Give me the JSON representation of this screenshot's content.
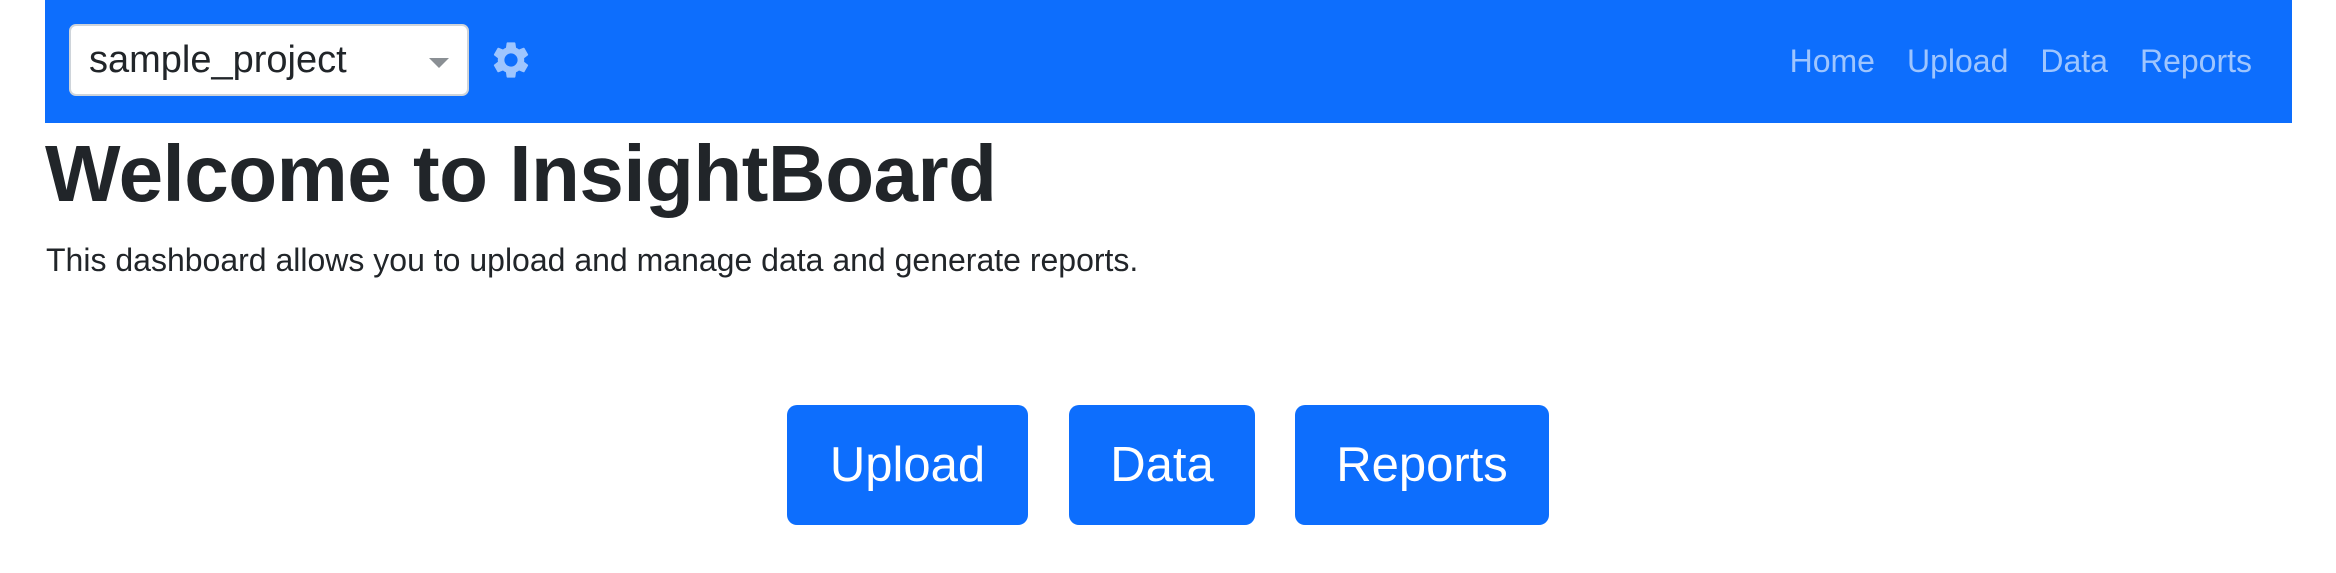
{
  "header": {
    "project_select": {
      "value": "sample_project"
    },
    "settings_icon": "gear-icon",
    "nav": [
      {
        "label": "Home"
      },
      {
        "label": "Upload"
      },
      {
        "label": "Data"
      },
      {
        "label": "Reports"
      }
    ]
  },
  "main": {
    "title": "Welcome to InsightBoard",
    "description": "This dashboard allows you to upload and manage data and generate reports.",
    "buttons": [
      {
        "label": "Upload"
      },
      {
        "label": "Data"
      },
      {
        "label": "Reports"
      }
    ]
  },
  "colors": {
    "primary": "#0d6efd",
    "nav_link": "#9ec5fe",
    "text": "#212529"
  }
}
